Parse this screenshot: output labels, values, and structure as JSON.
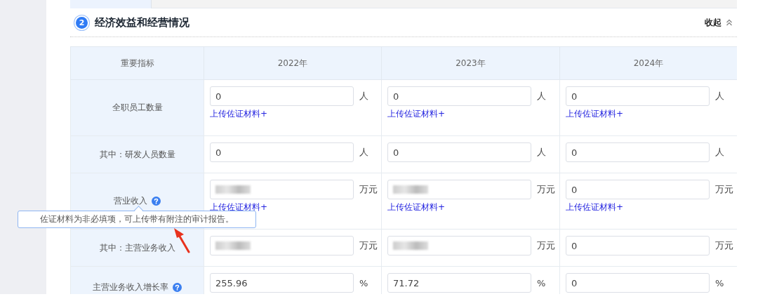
{
  "section": {
    "step": "2",
    "title": "经济效益和经营情况",
    "collapse_label": "收起"
  },
  "table": {
    "label_header": "重要指标",
    "years": [
      "2022年",
      "2023年",
      "2024年"
    ],
    "rows": [
      {
        "label": "全职员工数量",
        "help": false,
        "cells": [
          {
            "value": "0",
            "redacted": false,
            "unit": "人",
            "upload": "上传佐证材料+"
          },
          {
            "value": "0",
            "redacted": false,
            "unit": "人",
            "upload": "上传佐证材料+"
          },
          {
            "value": "0",
            "redacted": false,
            "unit": "人",
            "upload": "上传佐证材料+"
          }
        ]
      },
      {
        "label": "其中：研发人员数量",
        "help": false,
        "cells": [
          {
            "value": "0",
            "redacted": false,
            "unit": "人"
          },
          {
            "value": "0",
            "redacted": false,
            "unit": "人"
          },
          {
            "value": "0",
            "redacted": false,
            "unit": "人"
          }
        ]
      },
      {
        "label": "营业收入",
        "help": true,
        "cells": [
          {
            "redacted": true,
            "unit": "万元",
            "upload": "上传佐证材料+"
          },
          {
            "redacted": true,
            "unit": "万元",
            "upload": "上传佐证材料+"
          },
          {
            "value": "0",
            "redacted": false,
            "unit": "万元",
            "upload": "上传佐证材料+"
          }
        ]
      },
      {
        "label": "其中：主营业务收入",
        "help": false,
        "cells": [
          {
            "redacted": true,
            "unit": "万元"
          },
          {
            "redacted": true,
            "unit": "万元"
          },
          {
            "value": "0",
            "redacted": false,
            "unit": "万元"
          }
        ]
      },
      {
        "label": "主营业务收入增长率",
        "help": true,
        "cells": [
          {
            "value": "255.96",
            "redacted": false,
            "unit": "%"
          },
          {
            "value": "71.72",
            "redacted": false,
            "unit": "%"
          },
          {
            "value": "0",
            "redacted": false,
            "unit": "%"
          }
        ]
      }
    ]
  },
  "tooltip": {
    "text": "佐证材料为非必填项，可上传带有附注的审计报告。"
  }
}
